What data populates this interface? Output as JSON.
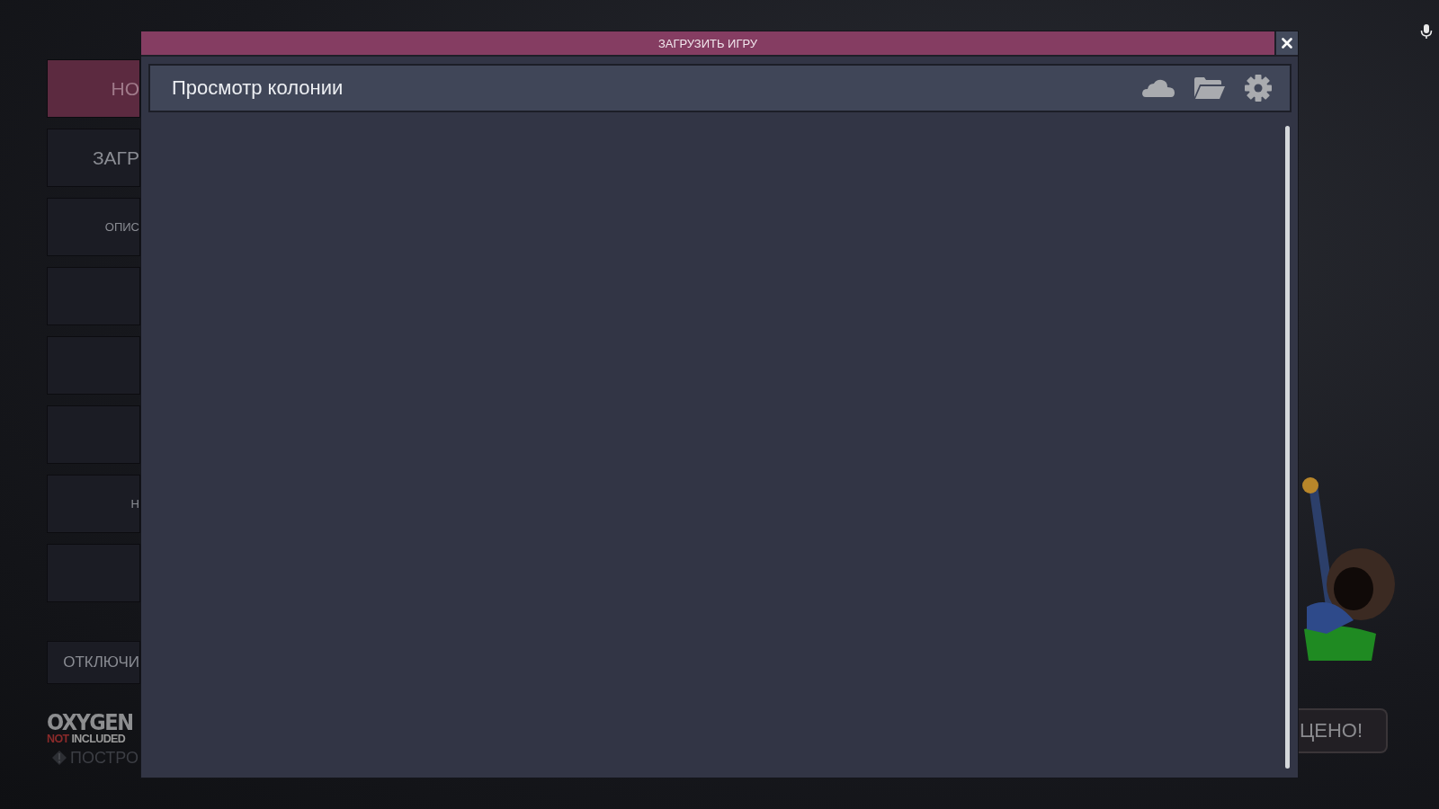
{
  "background_menu": {
    "items": [
      {
        "label": "НО",
        "kind": "large",
        "selected": true
      },
      {
        "label": "ЗАГР",
        "kind": "large",
        "selected": false
      },
      {
        "label": "ОПИС",
        "kind": "small",
        "selected": false
      },
      {
        "kind": "large",
        "selected": false
      },
      {
        "kind": "large",
        "selected": false
      },
      {
        "kind": "large",
        "selected": false
      },
      {
        "label": "Н",
        "kind": "small",
        "selected": false
      },
      {
        "kind": "large",
        "selected": false
      }
    ],
    "exit_button": "ОТКЛЮЧИ"
  },
  "logo": {
    "line_1": "OXYGEN",
    "line_2_accent": "NOT",
    "line_2": "INCLUDED"
  },
  "notice": "ПОСТРО",
  "side_button": "ЦЕНО!",
  "dialog": {
    "title": "ЗАГРУЗИТЬ ИГРУ",
    "header": {
      "title": "Просмотр колонии"
    }
  }
}
